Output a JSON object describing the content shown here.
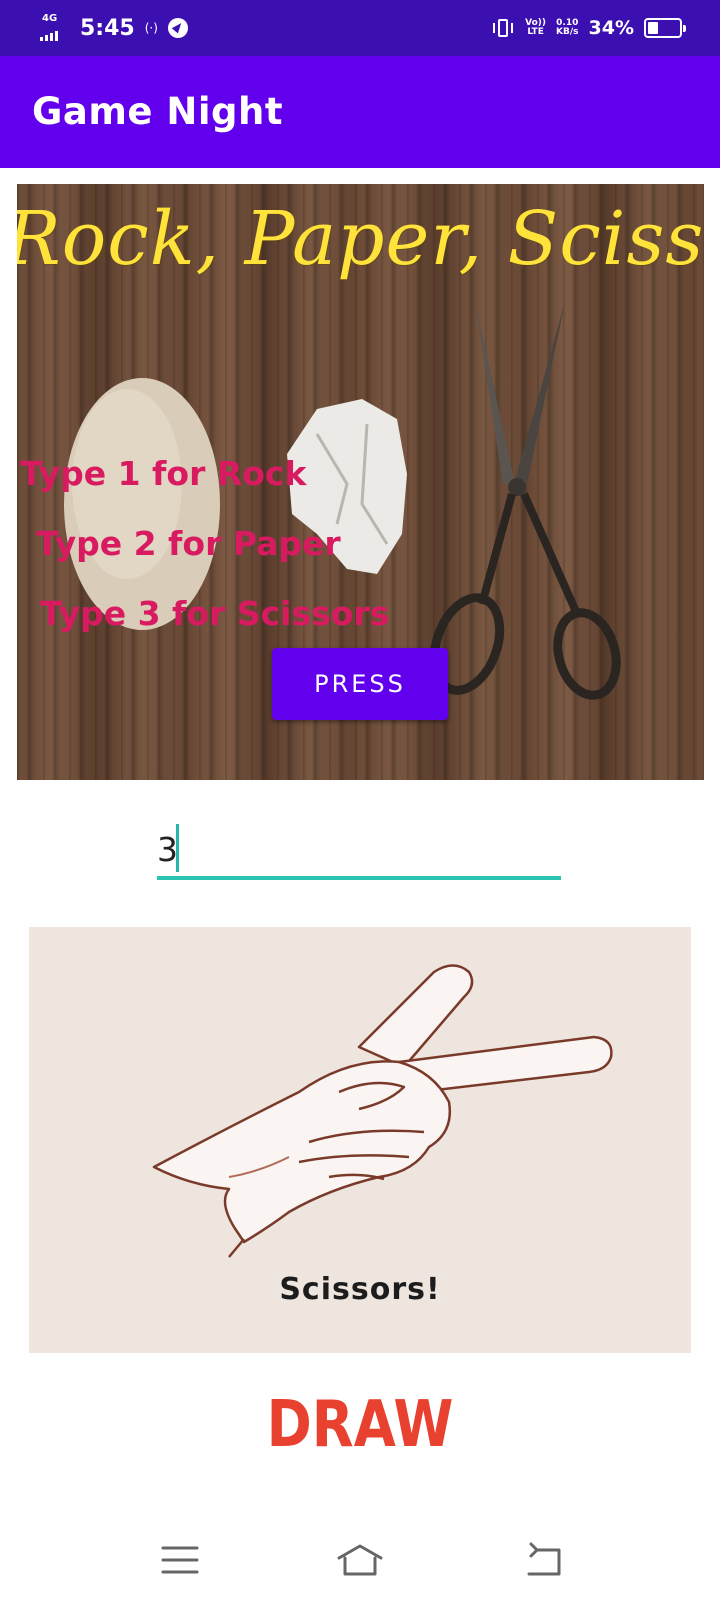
{
  "status_bar": {
    "network": "4G",
    "time": "5:45",
    "hotspot": "(·)",
    "volte_top": "Vo))",
    "volte_bottom": "LTE",
    "speed_top": "0.10",
    "speed_bottom": "KB/s",
    "battery_percent": "34%",
    "battery_level": 0.34
  },
  "app_bar": {
    "title": "Game Night",
    "color": "#6200ee"
  },
  "hero": {
    "title": "Rock, Paper, Scissors",
    "instructions": [
      "Type 1 for Rock",
      "Type 2 for Paper",
      "Type 3 for Scissors"
    ],
    "press_label": "PRESS"
  },
  "input": {
    "value": "3"
  },
  "result": {
    "caption": "Scissors!"
  },
  "outcome": {
    "text": "DRAW",
    "color": "#e8412f"
  },
  "nav": {
    "icons": [
      "menu-icon",
      "home-icon",
      "back-icon"
    ]
  }
}
